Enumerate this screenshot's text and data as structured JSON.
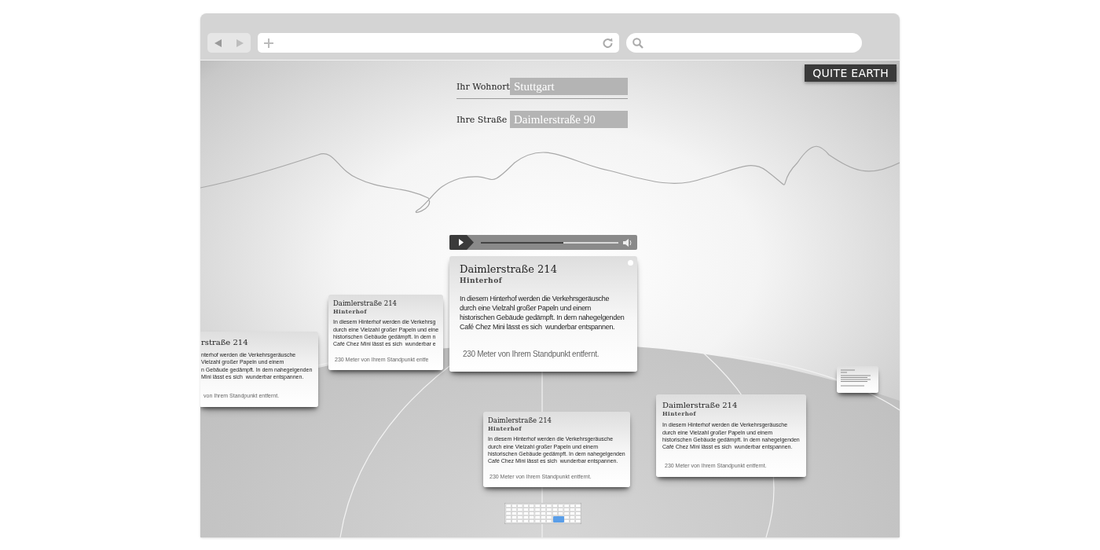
{
  "location_form": {
    "fields": [
      {
        "label": "Ihr Wohnort",
        "value": "Stuttgart"
      },
      {
        "label": "Ihre Straße",
        "value": "Daimlerstraße 90"
      }
    ]
  },
  "logo": "QUITE EARTH",
  "player": {
    "level": 0.6
  },
  "cards": [
    {
      "kind": "medium",
      "title": "rstraße 214",
      "body": "nterhof werden die Verkehrsgeräusche\nVielzahl großer Papeln und einem\nn Gebäude gedämpft. In dem nahegelgenden\nMini lässt es sich  wunderbar entspannen.",
      "distance": "von Ihrem Standpunkt entfernt."
    },
    {
      "kind": "small",
      "title": "Daimlerstraße 214",
      "subtitle": "Hinterhof",
      "body": "In diesem Hinterhof werden die Verkehrsg\ndurch eine Vielzahl großer Papeln und eine\nhistorischen Gebäude gedämpft. In dem n\nCafé Chez Mini lässt es sich  wunderbar e",
      "distance": "230 Meter von Ihrem Standpunkt entfe"
    },
    {
      "kind": "large",
      "title": "Daimlerstraße 214",
      "subtitle": "Hinterhof",
      "body": "In diesem Hinterhof werden die Verkehrsgeräusche\ndurch eine Vielzahl großer Papeln und einem\nhistorischen Gebäude gedämpft. In dem nahegelgenden\nCafé Chez Mini lässt es sich  wunderbar entspannen.",
      "distance": "230 Meter von Ihrem Standpunkt entfernt."
    },
    {
      "kind": "small",
      "title": "Daimlerstraße 214",
      "subtitle": "Hinterhof",
      "body": "In diesem Hinterhof werden die Verkehrsgeräusche\ndurch eine Vielzahl großer Papeln und einem\nhistorischen Gebäude gedämpft. In dem nahegelgenden\nCafé Chez Mini lässt es sich  wunderbar entspannen.",
      "distance": "230 Meter von Ihrem Standpunkt entfernt."
    },
    {
      "kind": "medium",
      "title": "Daimlerstraße 214",
      "subtitle": "Hinterhof",
      "body": "In diesem Hinterhof werden die Verkehrsgeräusche\ndurch eine Vielzahl großer Papeln und einem\nhistorischen Gebäude gedämpft. In dem nahegelgenden\nCafé Chez Mini lässt es sich  wunderbar entspannen.",
      "distance": "230 Meter von Ihrem Standpunkt entfernt."
    },
    {
      "kind": "tiny"
    }
  ]
}
